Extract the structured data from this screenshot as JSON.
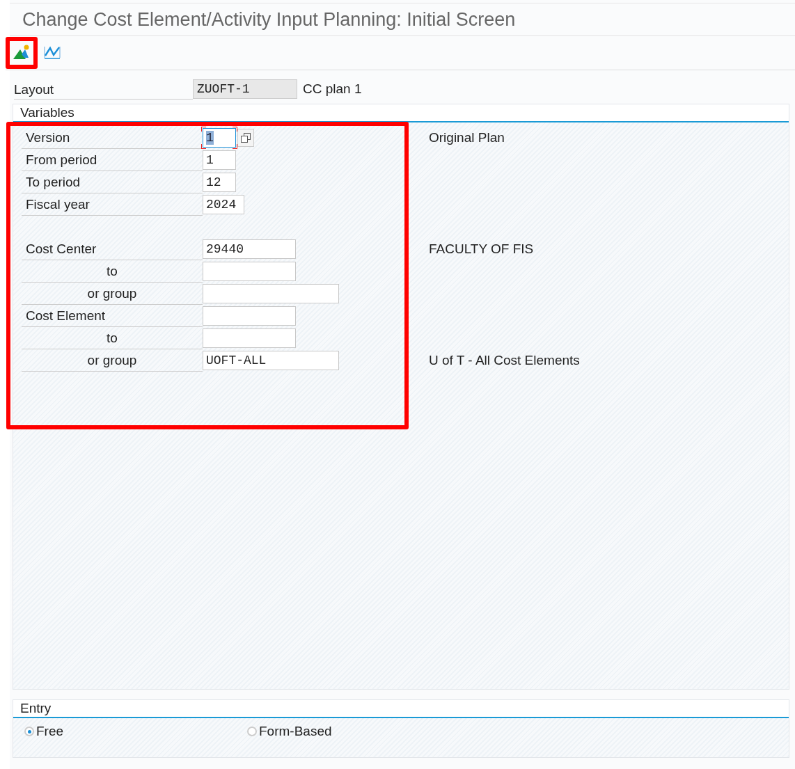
{
  "window": {
    "title": "Change Cost Element/Activity Input Planning: Initial Screen"
  },
  "toolbar": [
    {
      "kind": "landscape",
      "highlighted": true
    },
    {
      "kind": "curve",
      "highlighted": false
    }
  ],
  "layout": {
    "label": "Layout",
    "value": "ZUOFT-1",
    "description": "CC plan 1"
  },
  "variables": {
    "title": "Variables",
    "highlighted": true,
    "sections": [
      {
        "rows": [
          {
            "label": "Version",
            "value": "1",
            "kind": "short",
            "indent": false,
            "focused": true,
            "description": "Original Plan"
          },
          {
            "label": "From period",
            "value": "1",
            "kind": "short",
            "indent": false,
            "focused": false
          },
          {
            "label": "To period",
            "value": "12",
            "kind": "short",
            "indent": false,
            "focused": false
          },
          {
            "label": "Fiscal year",
            "value": "2024",
            "kind": "year",
            "indent": false,
            "focused": false
          }
        ]
      },
      {
        "rows": [
          {
            "label": "Cost Center",
            "value": "29440",
            "kind": "medium",
            "indent": false,
            "focused": false,
            "description": "FACULTY OF FIS"
          },
          {
            "label": "to",
            "kind": "medium",
            "indent": true,
            "focused": false
          },
          {
            "label": "or group",
            "kind": "wide",
            "indent": true,
            "focused": false
          },
          {
            "label": "Cost Element",
            "kind": "medium",
            "indent": false,
            "focused": false
          },
          {
            "label": "to",
            "kind": "medium",
            "indent": true,
            "focused": false
          },
          {
            "label": "or group",
            "value": "UOFT-ALL",
            "kind": "wide",
            "indent": true,
            "focused": false,
            "description": "U of T - All Cost Elements"
          }
        ]
      }
    ]
  },
  "entry": {
    "title": "Entry",
    "options": [
      {
        "label": "Free",
        "selected": true
      },
      {
        "label": "Form-Based",
        "selected": false
      }
    ]
  }
}
